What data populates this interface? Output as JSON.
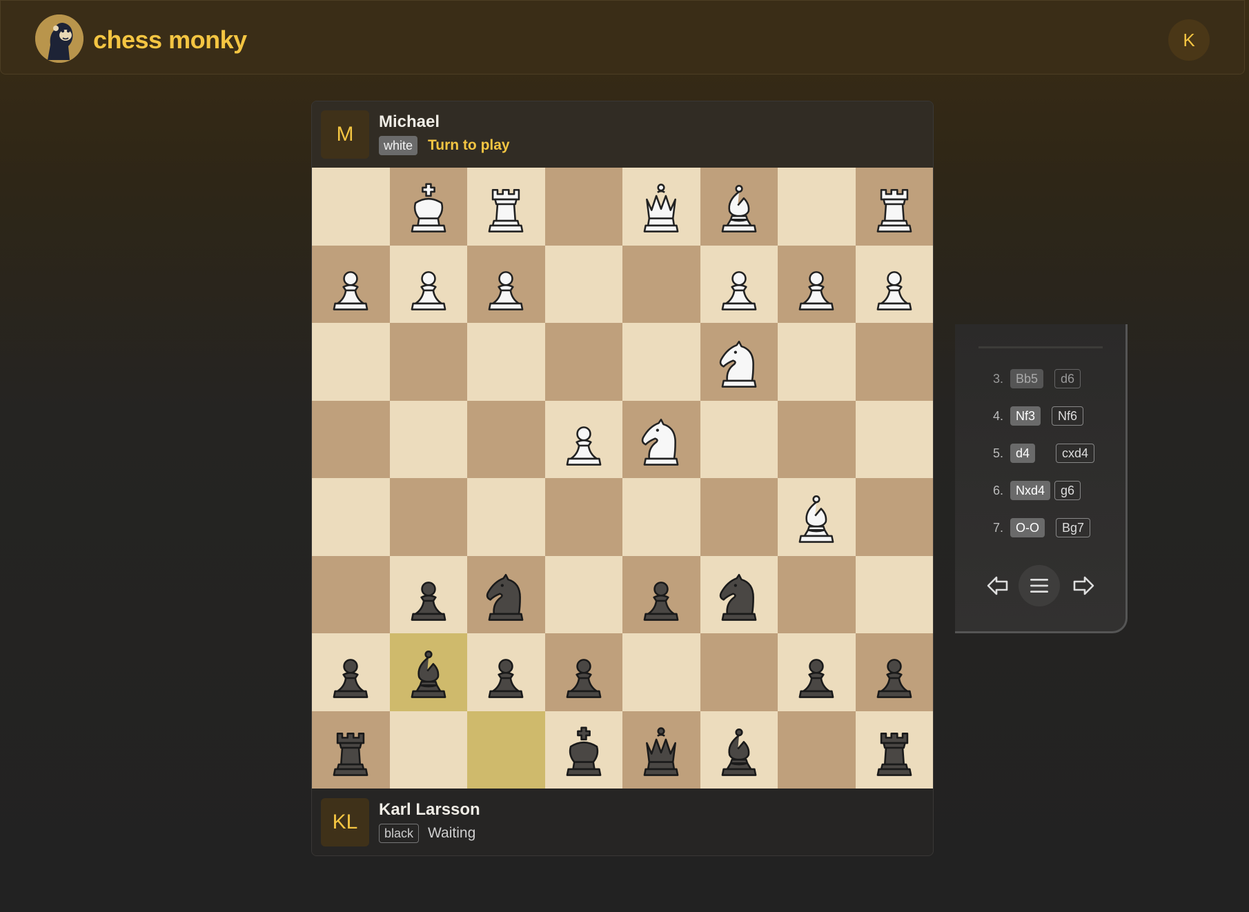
{
  "header": {
    "brand": "chess monky",
    "logo_icon": "monkey-knight-logo",
    "user_initial": "K"
  },
  "players": {
    "top": {
      "initial": "M",
      "name": "Michael",
      "color": "white",
      "status": "Turn to play"
    },
    "bottom": {
      "initial": "KL",
      "name": "Karl Larsson",
      "color": "black",
      "status": "Waiting"
    }
  },
  "board": {
    "light_color": "#ecdcbd",
    "dark_color": "#bfa07c",
    "highlight_color": "#cfba6c",
    "highlighted": [
      "6,1",
      "7,2"
    ],
    "rows": [
      [
        "",
        "wK",
        "wR",
        "",
        "wQ",
        "wB",
        "",
        "wR"
      ],
      [
        "wP",
        "wP",
        "wP",
        "",
        "",
        "wP",
        "wP",
        "wP"
      ],
      [
        "",
        "",
        "",
        "",
        "",
        "wN",
        "",
        ""
      ],
      [
        "",
        "",
        "",
        "wP",
        "wN",
        "",
        "",
        ""
      ],
      [
        "",
        "",
        "",
        "",
        "",
        "",
        "wB",
        ""
      ],
      [
        "",
        "bP",
        "bN",
        "",
        "bP",
        "bN",
        "",
        ""
      ],
      [
        "bP",
        "bB",
        "bP",
        "bP",
        "",
        "",
        "bP",
        "bP"
      ],
      [
        "bR",
        "",
        "",
        "bK",
        "bQ",
        "bB",
        "",
        "bR"
      ]
    ]
  },
  "moves": [
    {
      "num": "3.",
      "white": "Bb5",
      "black": "d6"
    },
    {
      "num": "4.",
      "white": "Nf3",
      "black": "Nf6"
    },
    {
      "num": "5.",
      "white": "d4",
      "black": "cxd4"
    },
    {
      "num": "6.",
      "white": "Nxd4",
      "black": "g6"
    },
    {
      "num": "7.",
      "white": "O-O",
      "black": "Bg7"
    }
  ],
  "nav": {
    "prev_icon": "arrow-left-icon",
    "menu_icon": "menu-icon",
    "next_icon": "arrow-right-icon"
  }
}
